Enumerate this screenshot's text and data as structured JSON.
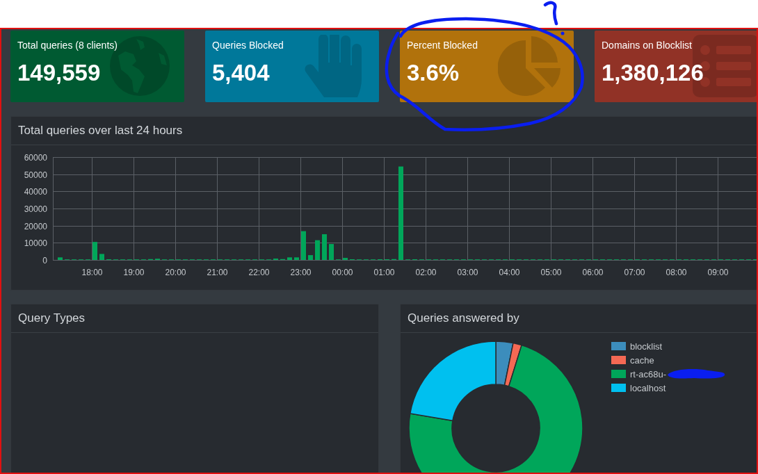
{
  "stats": [
    {
      "label": "Total queries (8 clients)",
      "value": "149,559",
      "color": "#005a32"
    },
    {
      "label": "Queries Blocked",
      "value": "5,404",
      "color": "#00789a"
    },
    {
      "label": "Percent Blocked",
      "value": "3.6%",
      "color": "#b1720c"
    },
    {
      "label": "Domains on Blocklist",
      "value": "1,380,126",
      "color": "#913226"
    }
  ],
  "queries_chart": {
    "title": "Total queries over last 24 hours",
    "chart_data": {
      "type": "bar",
      "color": "#00a65a",
      "grid": true,
      "categories": [
        null,
        null,
        null,
        null,
        null,
        "18:00",
        null,
        null,
        null,
        null,
        null,
        "19:00",
        null,
        null,
        null,
        null,
        null,
        "20:00",
        null,
        null,
        null,
        null,
        null,
        "21:00",
        null,
        null,
        null,
        null,
        null,
        "22:00",
        null,
        null,
        null,
        null,
        null,
        "23:00",
        null,
        null,
        null,
        null,
        null,
        "00:00",
        null,
        null,
        null,
        null,
        null,
        "01:00",
        null,
        null,
        null,
        null,
        null,
        "02:00",
        null,
        null,
        null,
        null,
        null,
        "03:00",
        null,
        null,
        null,
        null,
        null,
        "04:00",
        null,
        null,
        null,
        null,
        null,
        "05:00",
        null,
        null,
        null,
        null,
        null,
        "06:00",
        null,
        null,
        null,
        null,
        null,
        "07:00",
        null,
        null,
        null,
        null,
        null,
        "08:00",
        null,
        null,
        null,
        null,
        null,
        "09:00",
        null,
        null,
        null,
        null,
        null
      ],
      "values": [
        1500,
        300,
        100,
        100,
        100,
        10500,
        3500,
        400,
        0,
        0,
        0,
        0,
        100,
        500,
        700,
        100,
        100,
        0,
        0,
        100,
        100,
        100,
        100,
        0,
        0,
        0,
        100,
        100,
        100,
        100,
        100,
        800,
        500,
        1500,
        1500,
        16800,
        2800,
        11500,
        15000,
        9300,
        100,
        1200,
        400,
        0,
        200,
        0,
        400,
        400,
        500,
        54500,
        100,
        400,
        100,
        100,
        0,
        100,
        100,
        0,
        0,
        0,
        0,
        0,
        0,
        0,
        0,
        0,
        0,
        0,
        0,
        0,
        0,
        0,
        0,
        0,
        0,
        0,
        0,
        0,
        100,
        0,
        0,
        0,
        0,
        0,
        0,
        0,
        0,
        0,
        0,
        0,
        0,
        0,
        100,
        0,
        0,
        0,
        0,
        0,
        0,
        300,
        400
      ],
      "ylim": [
        0,
        60000
      ],
      "yticks": [
        0,
        10000,
        20000,
        30000,
        40000,
        50000,
        60000
      ]
    }
  },
  "query_types": {
    "title": "Query Types"
  },
  "answered_by": {
    "title": "Queries answered by",
    "legend": [
      {
        "color": "#3c8dbc"
      },
      {
        "color": "#f56954"
      },
      {
        "color": "#00a65a"
      },
      {
        "color": "#00c0ef"
      }
    ],
    "chart_data": {
      "type": "donut",
      "categories": [
        "blocklist",
        "cache",
        "rt-ac68u-",
        "localhost"
      ],
      "values": [
        3.2,
        1.6,
        72.9,
        22.3
      ]
    }
  }
}
